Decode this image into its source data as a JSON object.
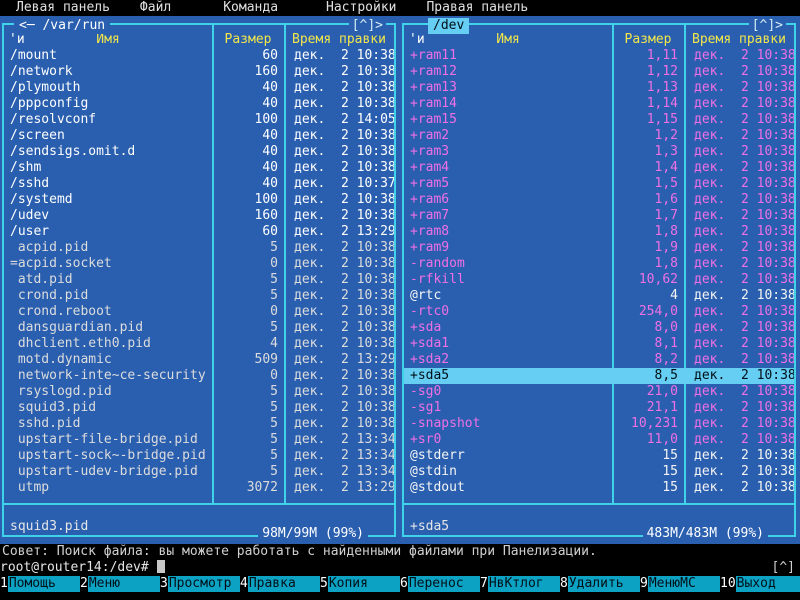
{
  "colors": {
    "panel_bg": "#2a5fb0",
    "frame": "#3fd2e8",
    "header_text": "#f1e64b",
    "device_text": "#ef70e4",
    "selection_bg": "#66cef2",
    "keybar_bg": "#0ca2c4"
  },
  "menubar": {
    "items": [
      "Левая панель",
      "Файл",
      "Команда",
      "Настройки",
      "Правая панель"
    ]
  },
  "panels": {
    "left": {
      "title": "<─ /var/run",
      "corner_marker": "[^]>",
      "sort_marker": "'и",
      "columns": {
        "name": "Имя",
        "size": "Размер",
        "mtime": "Время правки"
      },
      "rows": [
        {
          "name": "/mount",
          "size": "60",
          "mtime": "дек.  2 10:38",
          "type": "dir"
        },
        {
          "name": "/network",
          "size": "160",
          "mtime": "дек.  2 10:38",
          "type": "dir"
        },
        {
          "name": "/plymouth",
          "size": "40",
          "mtime": "дек.  2 10:38",
          "type": "dir"
        },
        {
          "name": "/pppconfig",
          "size": "40",
          "mtime": "дек.  2 10:38",
          "type": "dir"
        },
        {
          "name": "/resolvconf",
          "size": "100",
          "mtime": "дек.  2 14:05",
          "type": "dir"
        },
        {
          "name": "/screen",
          "size": "40",
          "mtime": "дек.  2 10:38",
          "type": "dir"
        },
        {
          "name": "/sendsigs.omit.d",
          "size": "40",
          "mtime": "дек.  2 10:38",
          "type": "dir"
        },
        {
          "name": "/shm",
          "size": "40",
          "mtime": "дек.  2 10:38",
          "type": "dir"
        },
        {
          "name": "/sshd",
          "size": "40",
          "mtime": "дек.  2 10:37",
          "type": "dir"
        },
        {
          "name": "/systemd",
          "size": "100",
          "mtime": "дек.  2 10:38",
          "type": "dir"
        },
        {
          "name": "/udev",
          "size": "160",
          "mtime": "дек.  2 10:38",
          "type": "dir"
        },
        {
          "name": "/user",
          "size": "60",
          "mtime": "дек.  2 13:29",
          "type": "dir"
        },
        {
          "name": " acpid.pid",
          "size": "5",
          "mtime": "дек.  2 10:38",
          "type": "file"
        },
        {
          "name": "=acpid.socket",
          "size": "0",
          "mtime": "дек.  2 10:38",
          "type": "file"
        },
        {
          "name": " atd.pid",
          "size": "5",
          "mtime": "дек.  2 10:38",
          "type": "file"
        },
        {
          "name": " crond.pid",
          "size": "5",
          "mtime": "дек.  2 10:38",
          "type": "file"
        },
        {
          "name": " crond.reboot",
          "size": "0",
          "mtime": "дек.  2 10:38",
          "type": "file"
        },
        {
          "name": " dansguardian.pid",
          "size": "5",
          "mtime": "дек.  2 10:38",
          "type": "file"
        },
        {
          "name": " dhclient.eth0.pid",
          "size": "4",
          "mtime": "дек.  2 10:38",
          "type": "file"
        },
        {
          "name": " motd.dynamic",
          "size": "509",
          "mtime": "дек.  2 13:29",
          "type": "file"
        },
        {
          "name": " network-inte~ce-security",
          "size": "0",
          "mtime": "дек.  2 10:38",
          "type": "file"
        },
        {
          "name": " rsyslogd.pid",
          "size": "5",
          "mtime": "дек.  2 10:38",
          "type": "file"
        },
        {
          "name": " squid3.pid",
          "size": "5",
          "mtime": "дек.  2 10:38",
          "type": "file"
        },
        {
          "name": " sshd.pid",
          "size": "5",
          "mtime": "дек.  2 10:38",
          "type": "file"
        },
        {
          "name": " upstart-file-bridge.pid",
          "size": "5",
          "mtime": "дек.  2 13:34",
          "type": "file"
        },
        {
          "name": " upstart-sock~-bridge.pid",
          "size": "5",
          "mtime": "дек.  2 13:34",
          "type": "file"
        },
        {
          "name": " upstart-udev-bridge.pid",
          "size": "5",
          "mtime": "дек.  2 13:34",
          "type": "file"
        },
        {
          "name": " utmp",
          "size": "3072",
          "mtime": "дек.  2 13:29",
          "type": "file"
        }
      ],
      "mini_status": "squid3.pid",
      "usage": "98M/99M (99%)"
    },
    "right": {
      "title": "/dev",
      "corner_marker": "[^]>",
      "sort_marker": "'и",
      "columns": {
        "name": "Имя",
        "size": "Размер",
        "mtime": "Время правки"
      },
      "rows": [
        {
          "name": "+ram11",
          "size": "1,11",
          "mtime": "дек.  2 10:38",
          "type": "device"
        },
        {
          "name": "+ram12",
          "size": "1,12",
          "mtime": "дек.  2 10:38",
          "type": "device"
        },
        {
          "name": "+ram13",
          "size": "1,13",
          "mtime": "дек.  2 10:38",
          "type": "device"
        },
        {
          "name": "+ram14",
          "size": "1,14",
          "mtime": "дек.  2 10:38",
          "type": "device"
        },
        {
          "name": "+ram15",
          "size": "1,15",
          "mtime": "дек.  2 10:38",
          "type": "device"
        },
        {
          "name": "+ram2",
          "size": "1,2",
          "mtime": "дек.  2 10:38",
          "type": "device"
        },
        {
          "name": "+ram3",
          "size": "1,3",
          "mtime": "дек.  2 10:38",
          "type": "device"
        },
        {
          "name": "+ram4",
          "size": "1,4",
          "mtime": "дек.  2 10:38",
          "type": "device"
        },
        {
          "name": "+ram5",
          "size": "1,5",
          "mtime": "дек.  2 10:38",
          "type": "device"
        },
        {
          "name": "+ram6",
          "size": "1,6",
          "mtime": "дек.  2 10:38",
          "type": "device"
        },
        {
          "name": "+ram7",
          "size": "1,7",
          "mtime": "дек.  2 10:38",
          "type": "device"
        },
        {
          "name": "+ram8",
          "size": "1,8",
          "mtime": "дек.  2 10:38",
          "type": "device"
        },
        {
          "name": "+ram9",
          "size": "1,9",
          "mtime": "дек.  2 10:38",
          "type": "device"
        },
        {
          "name": "-random",
          "size": "1,8",
          "mtime": "дек.  2 10:38",
          "type": "device"
        },
        {
          "name": "-rfkill",
          "size": "10,62",
          "mtime": "дек.  2 10:38",
          "type": "device"
        },
        {
          "name": "@rtc",
          "size": "4",
          "mtime": "дек.  2 10:38",
          "type": "link"
        },
        {
          "name": "-rtc0",
          "size": "254,0",
          "mtime": "дек.  2 10:38",
          "type": "device"
        },
        {
          "name": "+sda",
          "size": "8,0",
          "mtime": "дек.  2 10:38",
          "type": "device"
        },
        {
          "name": "+sda1",
          "size": "8,1",
          "mtime": "дек.  2 10:38",
          "type": "device"
        },
        {
          "name": "+sda2",
          "size": "8,2",
          "mtime": "дек.  2 10:38",
          "type": "device"
        },
        {
          "name": "+sda5",
          "size": "8,5",
          "mtime": "дек.  2 10:38",
          "type": "device",
          "selected": true
        },
        {
          "name": "-sg0",
          "size": "21,0",
          "mtime": "дек.  2 10:38",
          "type": "device"
        },
        {
          "name": "-sg1",
          "size": "21,1",
          "mtime": "дек.  2 10:38",
          "type": "device"
        },
        {
          "name": "-snapshot",
          "size": "10,231",
          "mtime": "дек.  2 10:38",
          "type": "device"
        },
        {
          "name": "+sr0",
          "size": "11,0",
          "mtime": "дек.  2 10:38",
          "type": "device"
        },
        {
          "name": "@stderr",
          "size": "15",
          "mtime": "дек.  2 10:38",
          "type": "link"
        },
        {
          "name": "@stdin",
          "size": "15",
          "mtime": "дек.  2 10:38",
          "type": "link"
        },
        {
          "name": "@stdout",
          "size": "15",
          "mtime": "дек.  2 10:38",
          "type": "link"
        }
      ],
      "mini_status": "+sda5",
      "usage": "483M/483M (99%)"
    }
  },
  "hint": "Совет: Поиск файла: вы можете работать с найденными файлами при Панелизации.",
  "prompt": "root@router14:/dev#",
  "history_marker": "[^]",
  "keybar": [
    {
      "num": "1",
      "label": "Помощь"
    },
    {
      "num": "2",
      "label": "Меню"
    },
    {
      "num": "3",
      "label": "Просмотр"
    },
    {
      "num": "4",
      "label": "Правка"
    },
    {
      "num": "5",
      "label": "Копия"
    },
    {
      "num": "6",
      "label": "Перенос"
    },
    {
      "num": "7",
      "label": "НвКтлог"
    },
    {
      "num": "8",
      "label": "Удалить"
    },
    {
      "num": "9",
      "label": "МенюМС"
    },
    {
      "num": "10",
      "label": "Выход"
    }
  ]
}
